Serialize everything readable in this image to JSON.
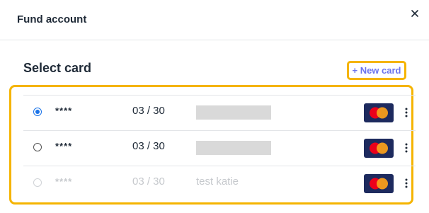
{
  "header": {
    "title": "Fund account"
  },
  "section": {
    "title": "Select card",
    "new_card_label": "+ New card"
  },
  "cards": [
    {
      "mask": "****",
      "expiry": "03 / 30",
      "holder": "",
      "brand": "MasterCard",
      "selected": true,
      "disabled": false
    },
    {
      "mask": "****",
      "expiry": "03 / 30",
      "holder": "",
      "brand": "MasterCard",
      "selected": false,
      "disabled": false
    },
    {
      "mask": "****",
      "expiry": "03 / 30",
      "holder": "test katie",
      "brand": "MasterCard",
      "selected": false,
      "disabled": true
    }
  ],
  "colors": {
    "accent": "#6b73ee",
    "highlight": "#f5b400",
    "radio_selected": "#1a73e8",
    "mastercard_red": "#eb001b",
    "mastercard_yellow": "#f79e1b"
  }
}
